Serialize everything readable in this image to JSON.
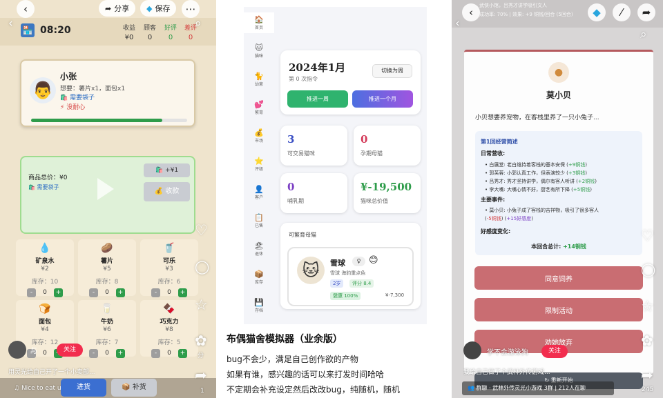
{
  "panel1": {
    "share_label": "分享",
    "save_label": "保存",
    "more_label": "⋯",
    "time": "08:20",
    "stats": [
      {
        "label": "收益",
        "value": "¥0"
      },
      {
        "label": "顾客",
        "value": "0"
      },
      {
        "label": "好评",
        "value": "0"
      },
      {
        "label": "差评",
        "value": "0"
      }
    ],
    "customer": {
      "name": "小张",
      "wants": "想要：薯片x1，面包x1",
      "need_bag": "需要袋子",
      "mood": "没耐心",
      "patience_progress": 0.84
    },
    "checkout": {
      "total": "商品总价：¥0",
      "need_bag": "需要袋子",
      "bag_button": "+¥1",
      "checkout_button": "收款"
    },
    "items": [
      {
        "icon": "💧",
        "name": "矿泉水",
        "price": "¥2",
        "stock": "库存：10",
        "qty": "0"
      },
      {
        "icon": "🥔",
        "name": "薯片",
        "price": "¥5",
        "stock": "库存：8",
        "qty": "0"
      },
      {
        "icon": "🥤",
        "name": "可乐",
        "price": "¥3",
        "stock": "库存：6",
        "qty": "0"
      },
      {
        "icon": "🍞",
        "name": "面包",
        "price": "¥4",
        "stock": "库存：12",
        "qty": "0"
      },
      {
        "icon": "🥛",
        "name": "牛奶",
        "price": "¥6",
        "stock": "库存：7",
        "qty": "0"
      },
      {
        "icon": "🍫",
        "name": "巧克力",
        "price": "¥8",
        "stock": "库存：5",
        "qty": "0"
      }
    ],
    "author_name": "与",
    "follow_label": "关注",
    "caption": "用灵光给自己开了一个小卖部...",
    "music": "Nice to eat u",
    "bottom_btn1": "进货",
    "bottom_btn2": "补货",
    "right_count1": "分",
    "right_count2": "1"
  },
  "panel2": {
    "sidebar": [
      "首页",
      "猫咪",
      "幼崽",
      "繁育",
      "市场",
      "评级",
      "客户",
      "已售",
      "退休",
      "库存",
      "存档"
    ],
    "date_title": "2024年1月",
    "command_count": "第 0 次指令",
    "toggle_week": "切换为周",
    "advance_week": "推进一周",
    "advance_month": "推进一个月",
    "stats": [
      {
        "value": "3",
        "label": "可交易猫咪",
        "color": "#3a4fc4"
      },
      {
        "value": "0",
        "label": "孕期母猫",
        "color": "#d43b5a"
      },
      {
        "value": "0",
        "label": "哺乳期",
        "color": "#7b3fc4"
      },
      {
        "value": "¥-19,500",
        "label": "猫咪总价值",
        "color": "#2e9c4a"
      }
    ],
    "breeding_title": "可繁育母猫",
    "cat": {
      "name": "雪球",
      "gender": "♀",
      "breed": "雪球 海豹重点色",
      "age": "2岁",
      "score": "评分 8.4",
      "health": "健康 100%",
      "price": "¥-7,300"
    },
    "post_title": "布偶猫舍模拟器（业余版）",
    "post_lines": [
      "bug不会少，满足自己创作欲的产物",
      "如果有谁，感兴趣的话可以来打发时间哈哈",
      "不定期会补充设定然后改改bug，纯随机，随机"
    ]
  },
  "panel3": {
    "top_line1": "武侠小馆，吕秀才讲学吸引文人",
    "top_line2": "成功率: 70% | 效果: +9 铜钱/回合 (5回合)",
    "name": "莫小贝",
    "intro": "小贝想要养宠物，在客栈里养了一只小兔子...",
    "report_title": "第1回经营简述",
    "daily_title": "日常营收:",
    "daily": [
      {
        "text": "白展堂: 老白维持着客栈的基本安保 (",
        "amount": "+9铜钱",
        "close": ")"
      },
      {
        "text": "郭芙蓉: 小郭认真工作，但表演较少 (",
        "amount": "+3铜钱",
        "close": ")"
      },
      {
        "text": "吕秀才: 秀才坚持讲学，偶尔有客人听讲 (",
        "amount": "+2铜钱",
        "close": ")"
      },
      {
        "text": "李大嘴: 大嘴心情不好，厨艺有所下降 (",
        "amount": "+5铜钱",
        "close": ")"
      }
    ],
    "events_title": "主要事件:",
    "event_text": "莫小贝: 小兔子成了客栈的吉祥物，吸引了很多客人",
    "event_minus": "-5铜钱",
    "event_plus": "+15好感度",
    "affinity_title": "好感度变化:",
    "total_label": "本回合总计:",
    "total_value": "+14铜钱",
    "btn_agree": "同意饲养",
    "btn_limit": "限制活动",
    "btn_persuade": "劝她放弃",
    "restart": "重新开始",
    "author_name": "学不会游泳狗",
    "follow_label": "关注",
    "caption": "我给自己做了个武林外传游戏...",
    "group": "群聊 · 武林外传灵光小游戏 3群 | 212人在聊",
    "right_count": "245"
  }
}
